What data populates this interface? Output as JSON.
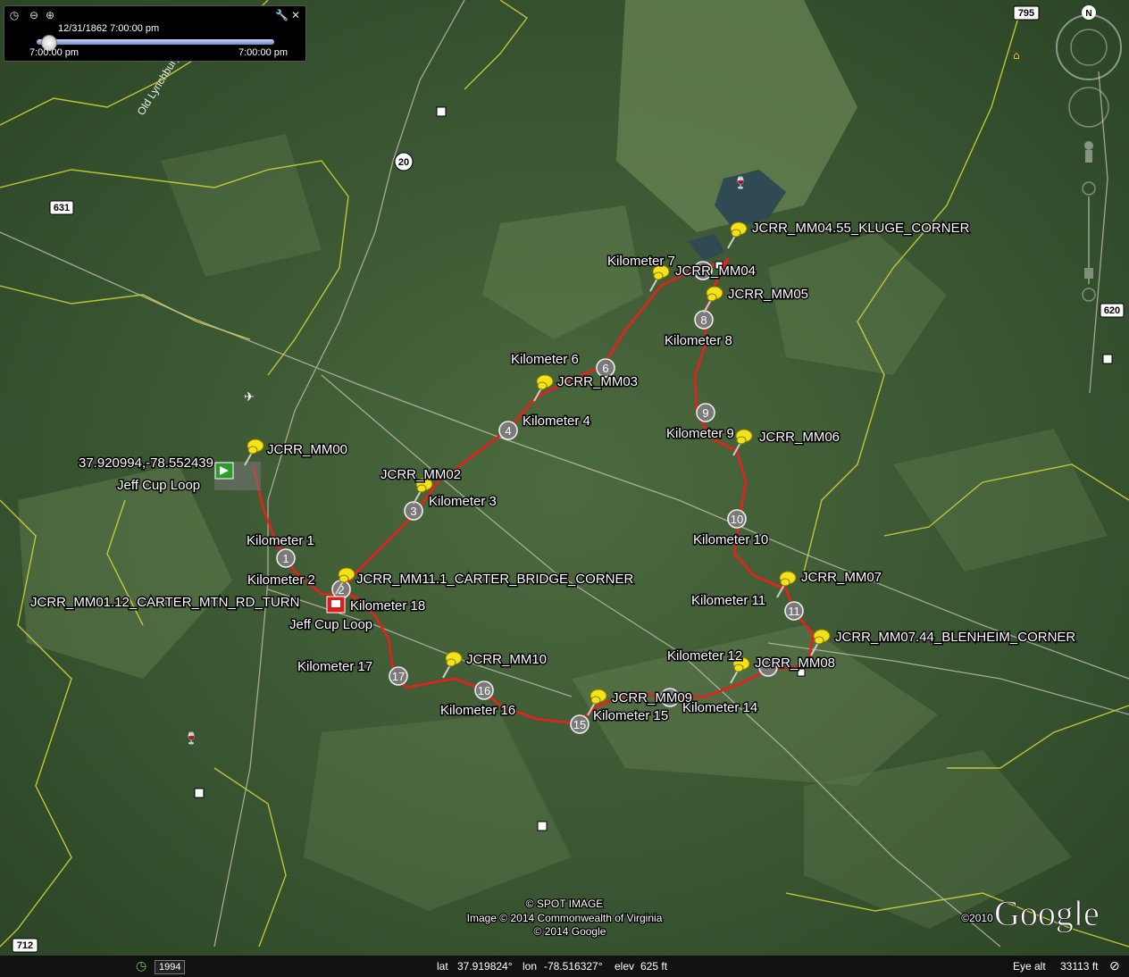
{
  "timeslider": {
    "current": "12/31/1862  7:00:00 pm",
    "start": "7:00:00 pm",
    "end": "7:00:00 pm",
    "position_fraction": 0.02
  },
  "roads": {
    "r795": "795",
    "r20": "20",
    "r631": "631",
    "r620": "620",
    "r712": "712",
    "north": "N",
    "road_name": "Old Lynchburg Rd"
  },
  "labels": {
    "mm00": "JCRR_MM00",
    "coords": "37.920994,-78.552439",
    "jeff_cup_loop_start": "Jeff Cup Loop",
    "jeff_cup_loop_end": "Jeff Cup Loop",
    "mm01": "JCRR_MM01.12_CARTER_MTN_RD_TURN",
    "mm02": "JCRR_MM02",
    "mm03": "JCRR_MM03",
    "mm04": "JCRR_MM04",
    "mm0455": "JCRR_MM04.55_KLUGE_CORNER",
    "mm05": "JCRR_MM05",
    "mm06": "JCRR_MM06",
    "mm07": "JCRR_MM07",
    "mm0744": "JCRR_MM07.44_BLENHEIM_CORNER",
    "mm08": "JCRR_MM08",
    "mm09": "JCRR_MM09",
    "mm10": "JCRR_MM10",
    "mm111": "JCRR_MM11.1_CARTER_BRIDGE_CORNER",
    "km1": "Kilometer 1",
    "km2": "Kilometer 2",
    "km3": "Kilometer 3",
    "km4": "Kilometer 4",
    "km6": "Kilometer 6",
    "km7": "Kilometer 7",
    "km8": "Kilometer 8",
    "km9": "Kilometer 9",
    "km10": "Kilometer 10",
    "km11": "Kilometer 11",
    "km12": "Kilometer 12",
    "km14": "Kilometer 14",
    "km15": "Kilometer 15",
    "km16": "Kilometer 16",
    "km17": "Kilometer 17",
    "km18": "Kilometer 18"
  },
  "km_markers": {
    "k1": "1",
    "k2": "2",
    "k3": "3",
    "k4": "4",
    "k6": "6",
    "k8": "8",
    "k9": "9",
    "k10": "10",
    "k11": "11",
    "k15": "15",
    "k16": "16",
    "k17": "17"
  },
  "credits": {
    "line1": "© SPOT IMAGE",
    "line2": "Image © 2014 Commonwealth of Virginia",
    "line3": "© 2014 Google",
    "year": "©2010",
    "logo": "Google"
  },
  "statusbar": {
    "year": "1994",
    "lat_label": "lat",
    "lat": "37.919824°",
    "lon_label": "lon",
    "lon": "-78.516327°",
    "elev_label": "elev",
    "elev": "625 ft",
    "eye_label": "Eye alt",
    "eye": "33113 ft"
  },
  "colors": {
    "route": "#e8201c",
    "border": "#d8d838",
    "pin": "#f3e21a"
  }
}
